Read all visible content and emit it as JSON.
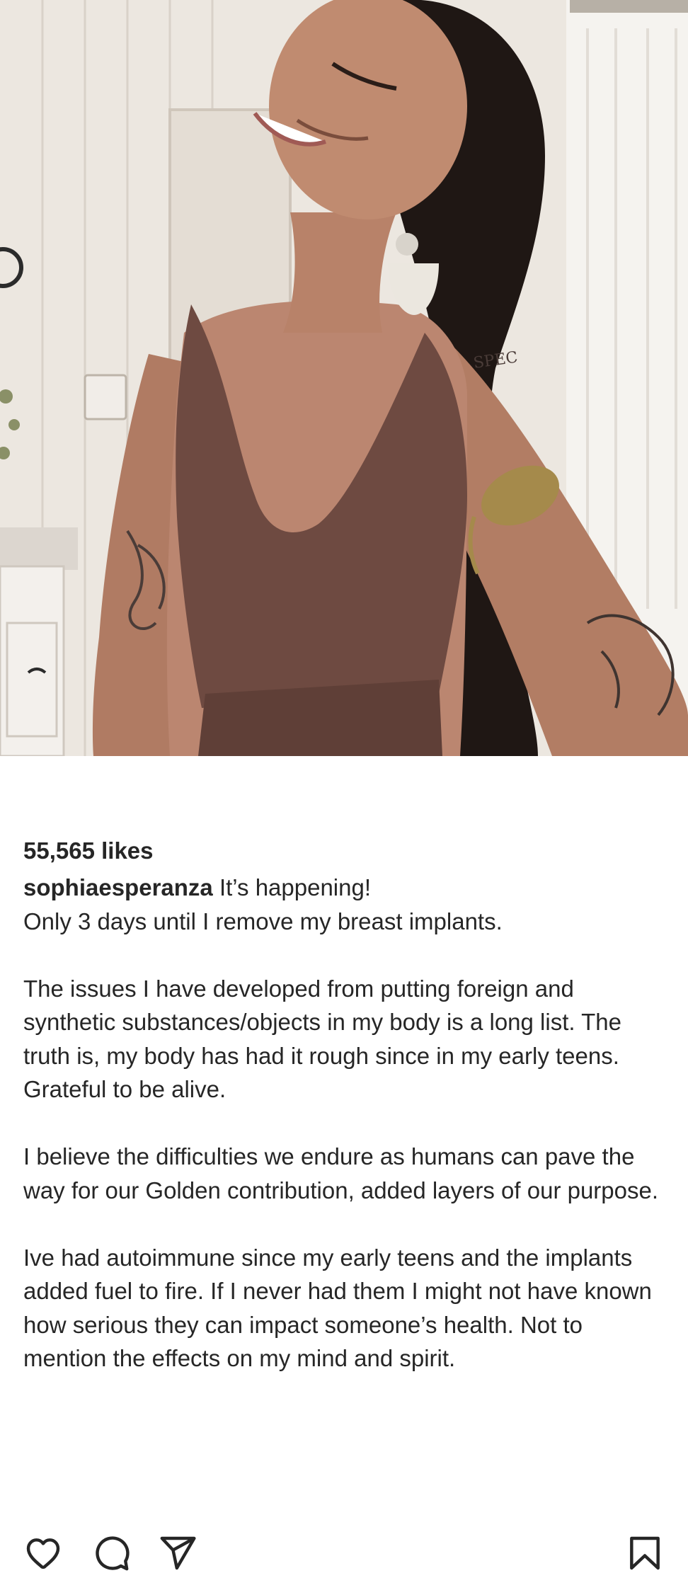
{
  "post": {
    "image_alt": "Selfie of a woman in a brown sports bra",
    "actions": {
      "like_icon": "heart-outline-icon",
      "comment_icon": "speech-bubble-icon",
      "share_icon": "paper-plane-icon",
      "save_icon": "bookmark-icon"
    },
    "likes": "55,565 likes",
    "caption": {
      "username": "sophiaesperanza",
      "first_line": " It’s happening!",
      "paragraphs": [
        "Only 3 days until I remove my breast implants.",
        "The issues I have developed from putting foreign and synthetic substances/objects in my body is a long list. The truth is, my body has had it rough since in my early teens. Grateful to be alive.",
        "I believe the difficulties we endure as humans can pave the way for our Golden contribution, added layers of our purpose.",
        "Ive had autoimmune since my early teens and the implants added fuel to fire. If I never had them I might not have known how serious they can impact someone’s health. Not to mention the effects on my mind and spirit."
      ]
    },
    "photo_text": {
      "tattoo_text": "SPEC"
    }
  }
}
